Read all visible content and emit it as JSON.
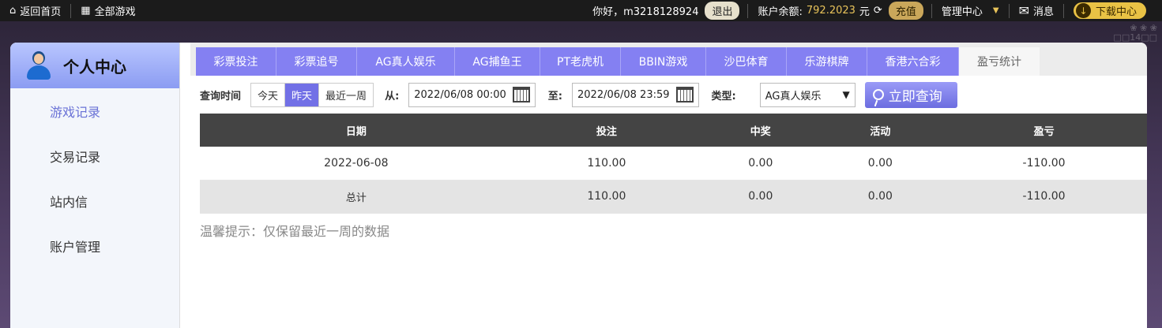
{
  "topbar": {
    "home": "返回首页",
    "all_games": "全部游戏",
    "greeting": "你好，m3218128924",
    "logout": "退出",
    "balance_label": "账户余额:",
    "balance_value": "792.2023",
    "currency": "元",
    "recharge": "充值",
    "manage": "管理中心",
    "messages": "消息",
    "download": "下载中心"
  },
  "sidebar": {
    "title": "个人中心",
    "items": [
      {
        "label": "游戏记录",
        "active": true
      },
      {
        "label": "交易记录"
      },
      {
        "label": "站内信"
      },
      {
        "label": "账户管理"
      }
    ]
  },
  "tabs": [
    {
      "label": "彩票投注",
      "w": 102
    },
    {
      "label": "彩票追号",
      "w": 102
    },
    {
      "label": "AG真人娱乐",
      "w": 124
    },
    {
      "label": "AG捕鱼王",
      "w": 108
    },
    {
      "label": "PT老虎机",
      "w": 102
    },
    {
      "label": "BBIN游戏",
      "w": 108
    },
    {
      "label": "沙巴体育",
      "w": 102
    },
    {
      "label": "乐游棋牌",
      "w": 102
    },
    {
      "label": "香港六合彩",
      "w": 116
    },
    {
      "label": "盈亏统计",
      "w": 102,
      "active": true
    }
  ],
  "query": {
    "time_label": "查询时间",
    "ranges": [
      "今天",
      "昨天",
      "最近一周"
    ],
    "selected_range": "昨天",
    "from_label": "从:",
    "from_value": "2022/06/08 00:00",
    "to_label": "至:",
    "to_value": "2022/06/08 23:59",
    "type_label": "类型:",
    "type_value": "AG真人娱乐",
    "submit": "立即查询"
  },
  "table": {
    "headers": [
      "日期",
      "投注",
      "中奖",
      "活动",
      "盈亏"
    ],
    "rows": [
      [
        "2022-06-08",
        "110.00",
        "0.00",
        "0.00",
        "-110.00"
      ]
    ],
    "total": [
      "总计",
      "110.00",
      "0.00",
      "0.00",
      "-110.00"
    ]
  },
  "tip": "温馨提示：仅保留最近一周的数据",
  "colors": {
    "accent": "#8480f2",
    "topbar": "#1b1b1b",
    "header_row": "#444444",
    "download": "#e9c245"
  }
}
